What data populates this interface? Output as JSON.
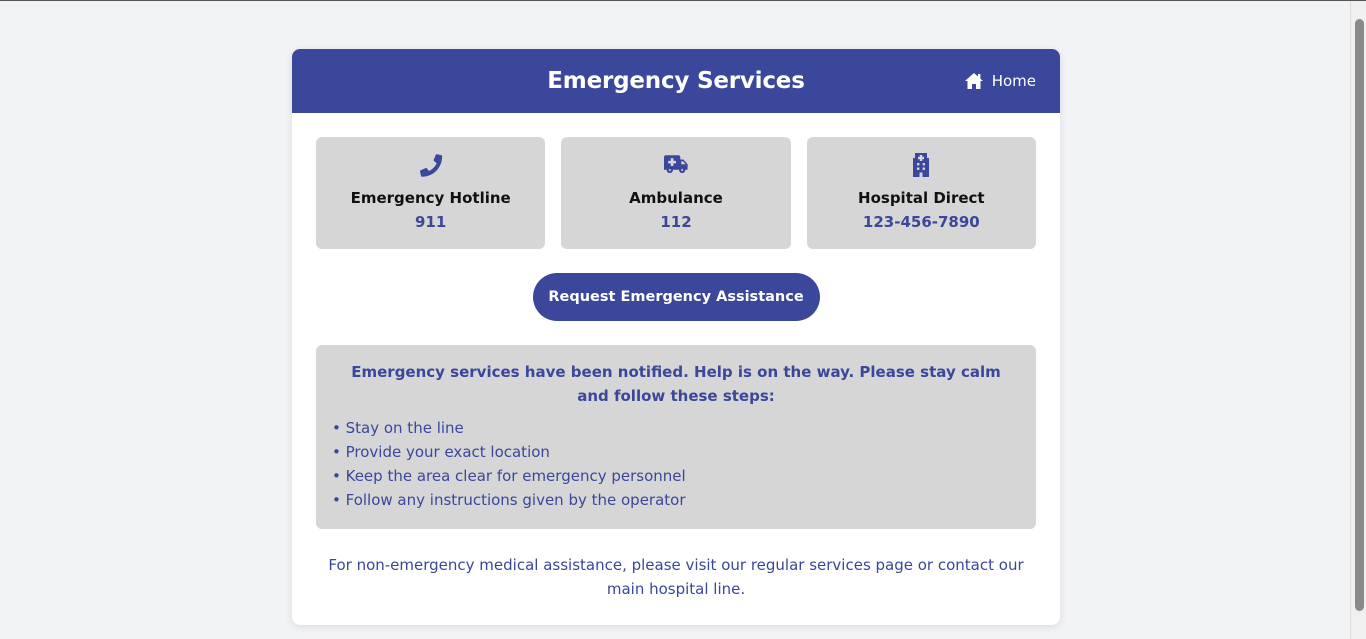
{
  "header": {
    "title": "Emergency Services",
    "home_label": "Home"
  },
  "contacts": [
    {
      "icon": "phone-icon",
      "label": "Emergency Hotline",
      "number": "911"
    },
    {
      "icon": "ambulance-icon",
      "label": "Ambulance",
      "number": "112"
    },
    {
      "icon": "hospital-icon",
      "label": "Hospital Direct",
      "number": "123-456-7890"
    }
  ],
  "action": {
    "button_label": "Request Emergency Assistance"
  },
  "notice": {
    "message": "Emergency services have been notified. Help is on the way. Please stay calm and follow these steps:",
    "steps": [
      "• Stay on the line",
      "• Provide your exact location",
      "• Keep the area clear for emergency personnel",
      "• Follow any instructions given by the operator"
    ]
  },
  "footer": {
    "text": "For non-emergency medical assistance, please visit our regular services page or contact our main hospital line."
  },
  "colors": {
    "primary": "#3a479b",
    "panel": "#d6d6d6",
    "background": "#f2f3f5"
  }
}
